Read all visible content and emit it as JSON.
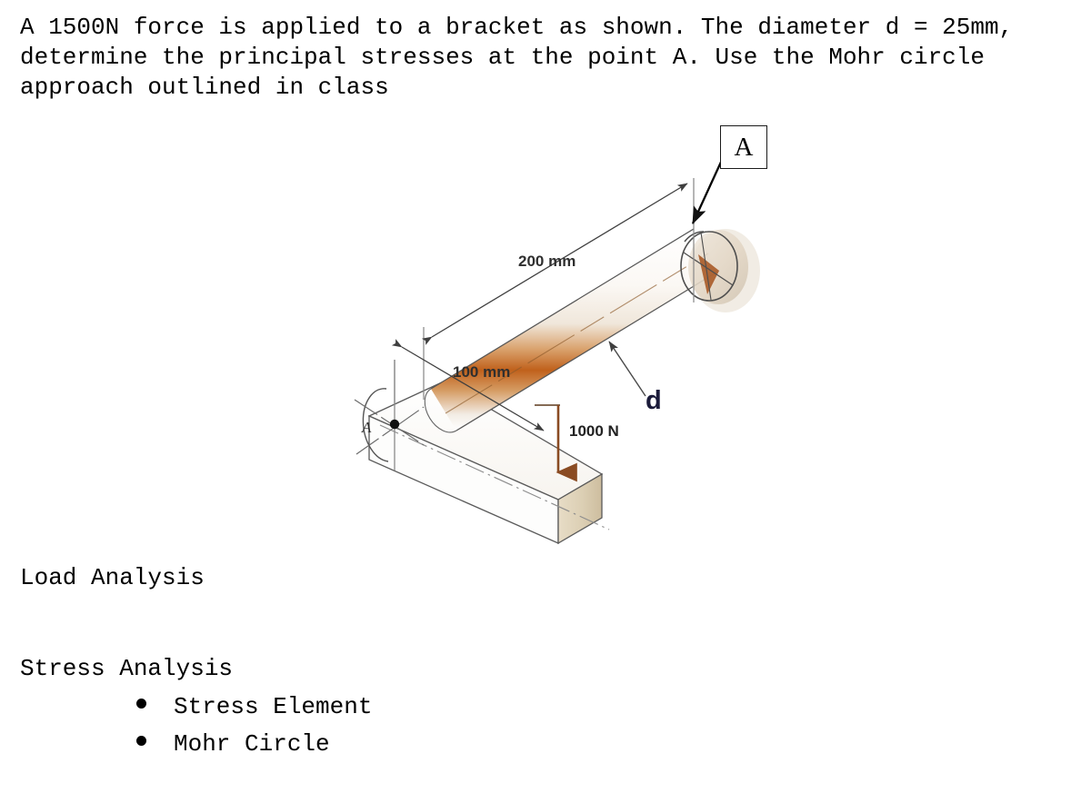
{
  "document": {
    "problem_statement": "A 1500N force is applied to a bracket as shown. The diameter d = 25mm, determine the principal stresses at the point A. Use the Mohr circle approach outlined in class",
    "sections": [
      {
        "heading": "Load Analysis"
      },
      {
        "heading": "Stress Analysis",
        "bullets": [
          {
            "label": "Stress Element"
          },
          {
            "label": "Mohr Circle"
          }
        ]
      }
    ]
  },
  "figure": {
    "callout_label": "A",
    "point_label": "A",
    "dimension_200": "200 mm",
    "dimension_100": "100 mm",
    "force_label": "1000 N",
    "diameter_label": "d",
    "colors": {
      "rod_rust": "#c0611c",
      "rod_light": "#f4f1ec",
      "bracket_face": "#ded0b8",
      "outline": "#4a4a4a",
      "force_arrow": "#8a4b22",
      "text": "#2a2a2a"
    }
  }
}
